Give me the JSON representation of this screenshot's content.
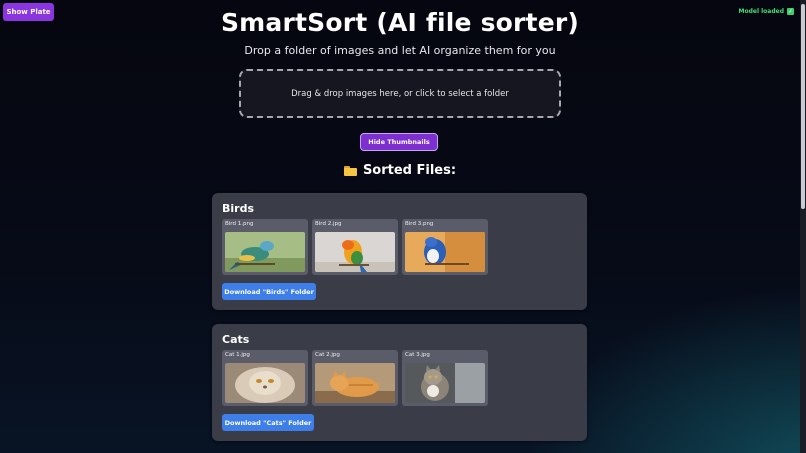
{
  "show_plate_label": "Show Plate",
  "model_status": "Model loaded",
  "title": "SmartSort (AI file sorter)",
  "subtitle": "Drop a folder of images and let AI organize them for you",
  "dropzone_text": "Drag & drop images here, or click to select a folder",
  "hide_thumbnails_label": "Hide Thumbnails",
  "sorted_heading": "Sorted Files:",
  "categories": [
    {
      "name": "Birds",
      "files": [
        {
          "name": "Bird 1.png",
          "image": "bird-blue-green-photo"
        },
        {
          "name": "Bird 2.jpg",
          "image": "sun-conure-photo"
        },
        {
          "name": "Bird 3.png",
          "image": "blue-jay-photo"
        }
      ],
      "download_label": "Download \"Birds\" Folder"
    },
    {
      "name": "Cats",
      "files": [
        {
          "name": "Cat 1.jpg",
          "image": "persian-cat-photo"
        },
        {
          "name": "Cat 2.jpg",
          "image": "orange-cat-photo"
        },
        {
          "name": "Cat 3.jpg",
          "image": "tabby-cat-photo"
        }
      ],
      "download_label": "Download \"Cats\" Folder"
    }
  ],
  "colors": {
    "accent_purple": "#8a35df",
    "download_blue": "#3d7ee8",
    "status_green": "#3ee07a",
    "card_bg": "#3a3d48"
  }
}
